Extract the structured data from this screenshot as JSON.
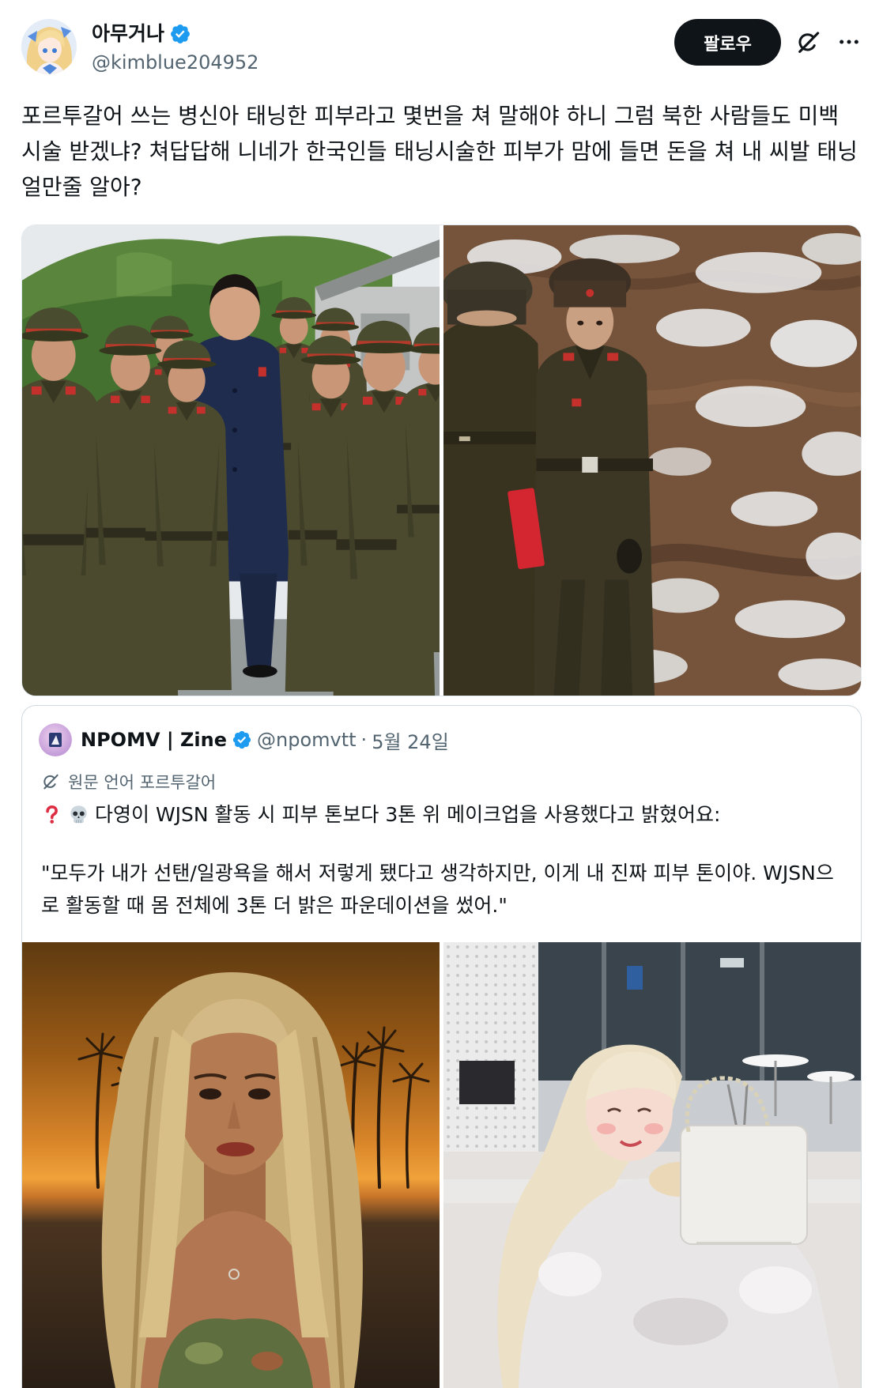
{
  "post": {
    "author": {
      "name": "아무거나",
      "handle": "@kimblue204952",
      "verified": true,
      "avatar_icon": "profile-avatar-icon",
      "verified_icon": "verified-badge-icon"
    },
    "actions": {
      "follow_label": "팔로우",
      "grok_icon": "grok-icon",
      "more_icon": "more-options-icon"
    },
    "text": "포르투갈어 쓰는 병신아 태닝한 피부라고 몇번을 쳐 말해야 하니 그럼 북한 사람들도 미백 시술 받겠냐? 쳐답답해 니네가 한국인들 태닝시술한 피부가 맘에 들면 돈을 쳐 내 씨발 태닝 얼만줄 알아?"
  },
  "quote": {
    "author": {
      "name": "NPOMV | Zine",
      "handle": "@npomvtt",
      "verified": true
    },
    "separator": "·",
    "date": "5월 24일",
    "translation": {
      "icon": "translation-icon",
      "note": "원문 언어 포르투갈어"
    },
    "lead": {
      "icons": [
        "red-question-mark-icon",
        "skull-icon"
      ],
      "text": "다영이 WJSN 활동 시 피부 톤보다 3톤 위 메이크업을 사용했다고 밝혔어요:"
    },
    "body": "\"모두가 내가 선탠/일광욕을 해서 저렇게 됐다고 생각하지만, 이게 내 진짜 피부 톤이야. WJSN으로 활동할 때 몸 전체에 3톤 더 밝은 파운데이션을 썼어.\""
  },
  "colors": {
    "text": "#0f1419",
    "secondary_text": "#536471",
    "verified": "#1d9bf0",
    "follow_button": "#0f1419",
    "border": "#cfd9de",
    "emoji_red": "#dd2e44"
  }
}
